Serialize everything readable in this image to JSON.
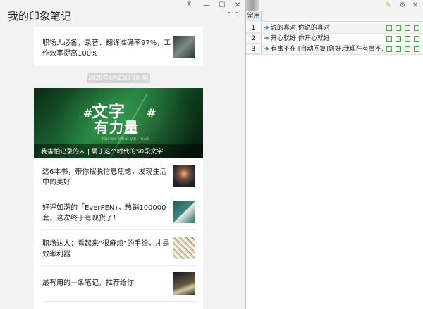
{
  "app": {
    "title": "我的印象笔记",
    "more_label": "···",
    "window_controls": {
      "pin": "⊼",
      "minimize": "—",
      "maximize": "☐",
      "close": "✕"
    }
  },
  "feed": {
    "card1": {
      "text": "职场人必备，录音、翻译准确率97%，工作效率提高100%"
    },
    "date_label": "2020年4月23日 18:44",
    "card2": {
      "banner": {
        "line1": "文字",
        "line2": "有力量",
        "hash": "#",
        "subtitle": "You are what you read",
        "caption": "我害怕记录的人 | 属于这个时代的50段文字"
      },
      "items": [
        {
          "text": "这6本书，带你摆脱信息焦虑，发现生活中的美好"
        },
        {
          "text": "好评如潮的「EverPEN」，热销100000套，这次终于有现货了！"
        },
        {
          "text": "职场达人：看起来“很麻烦”的手绘，才是效率利器"
        },
        {
          "text": "最有用的一条笔记，推荐给你"
        }
      ]
    }
  },
  "quick_reply": {
    "tab_label": "常用",
    "rows": [
      {
        "num": "1",
        "text": "说的真对 你说的真对"
      },
      {
        "num": "2",
        "text": "开心就好 你开心就好"
      },
      {
        "num": "3",
        "text": "有事不在 [自动回复]您好,我现在有事不..."
      }
    ],
    "row_arrow": "➜"
  },
  "colors": {
    "accent_blue": "#2b6bd1",
    "icon_green": "#4aa64a"
  }
}
